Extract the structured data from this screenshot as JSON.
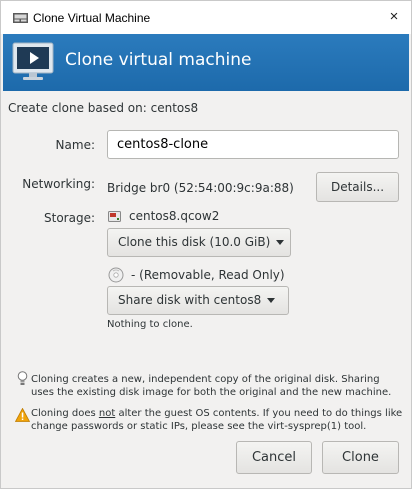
{
  "window": {
    "title": "Clone Virtual Machine",
    "close_glyph": "×",
    "app_icon": "vm-manager-icon"
  },
  "banner": {
    "title": "Clone virtual machine",
    "icon": "monitor-icon",
    "color": "#1d6aab"
  },
  "based_on": "Create clone based on: centos8",
  "name": {
    "label": "Name:",
    "value": "centos8-clone"
  },
  "networking": {
    "label": "Networking:",
    "value": "Bridge br0 (52:54:00:9c:9a:88)",
    "details_button": "Details..."
  },
  "storage": {
    "label": "Storage:",
    "disk1": {
      "icon": "disk-image-icon",
      "name": "centos8.qcow2",
      "option": "Clone this disk (10.0 GiB)"
    },
    "disk2": {
      "icon": "cdrom-icon",
      "name": "- (Removable, Read Only)",
      "option": "Share disk with centos8",
      "note": "Nothing to clone."
    }
  },
  "notes": {
    "info_icon": "lightbulb-icon",
    "info_text": "Cloning creates a new, independent copy of the original disk. Sharing uses the existing disk image for both the original and the new machine.",
    "warn_icon": "warning-icon",
    "warn_before": "Cloning does ",
    "warn_not": "not",
    "warn_after": " alter the guest OS contents. If you need to do things like change passwords or static IPs, please see the virt-sysprep(1) tool.",
    "warn_color": "#f0a30a"
  },
  "buttons": {
    "cancel": "Cancel",
    "clone": "Clone"
  }
}
